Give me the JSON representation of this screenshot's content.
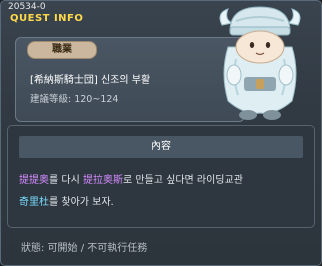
{
  "header": {
    "quest_id": "20534-0",
    "title": "QUEST INFO"
  },
  "card": {
    "job_label": "職業",
    "quest_name": "[希納斯騎士団] 신조의 부활",
    "level": "建議等級: 120~124"
  },
  "npc": {
    "icon": "snowman-npc-icon"
  },
  "panel": {
    "header": "內容",
    "desc_hl1": "提提奥",
    "desc_p1": "를 다시 ",
    "desc_hl2": "提拉奥斯",
    "desc_p2": "로 만들고 싶다면 라이딩교관",
    "desc_hl3": "奇里杜",
    "desc_p3": "를 찾아가 보자."
  },
  "footer": {
    "status": "狀態: 可開始 / 不可執行任務"
  },
  "colors": {
    "title": "#ffd94a",
    "highlight_purple": "#d58bff",
    "highlight_cyan": "#78dcff"
  }
}
